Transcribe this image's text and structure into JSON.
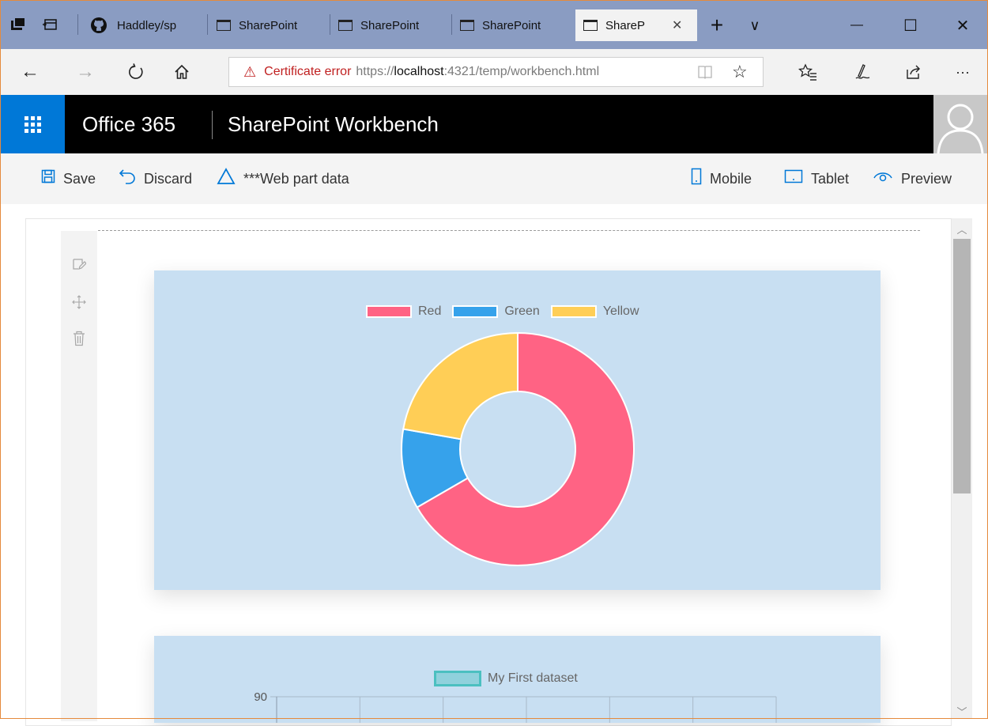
{
  "browser": {
    "tabs": [
      {
        "label": "Haddley/sp",
        "icon": "github-icon"
      },
      {
        "label": "SharePoint",
        "icon": "page-icon"
      },
      {
        "label": "SharePoint",
        "icon": "page-icon"
      },
      {
        "label": "SharePoint",
        "icon": "page-icon"
      },
      {
        "label": "ShareP",
        "icon": "page-icon"
      }
    ],
    "new_tab": "+",
    "tab_menu": "∨",
    "minimize": "—",
    "maximize": "☐",
    "close": "✕",
    "tab_close": "✕",
    "address": {
      "warning": "Certificate error",
      "url_prefix": "https://",
      "url_host": "localhost",
      "url_rest": ":4321/temp/workbench.html"
    },
    "more": "···"
  },
  "suite": {
    "brand": "Office 365",
    "app_title": "SharePoint Workbench"
  },
  "commands": {
    "save": "Save",
    "discard": "Discard",
    "webpart_data": "***Web part data",
    "mobile": "Mobile",
    "tablet": "Tablet",
    "preview": "Preview"
  },
  "colors": {
    "red": "#ff6384",
    "green": "#36a2eb",
    "yellow": "#ffce56",
    "teal": "#4bc0c0",
    "part_bg": "#c8dff2"
  },
  "chart_data": [
    {
      "type": "pie",
      "variant": "doughnut",
      "series": [
        {
          "name": "Red",
          "value": 300,
          "color": "#ff6384"
        },
        {
          "name": "Green",
          "value": 50,
          "color": "#36a2eb"
        },
        {
          "name": "Yellow",
          "value": 100,
          "color": "#ffce56"
        }
      ],
      "legend": "top"
    },
    {
      "type": "bar",
      "series": [
        {
          "name": "My First dataset",
          "color": "#4bc0c0"
        }
      ],
      "yticks_visible": [
        "90"
      ],
      "ylim_max": 90,
      "legend": "top"
    }
  ]
}
